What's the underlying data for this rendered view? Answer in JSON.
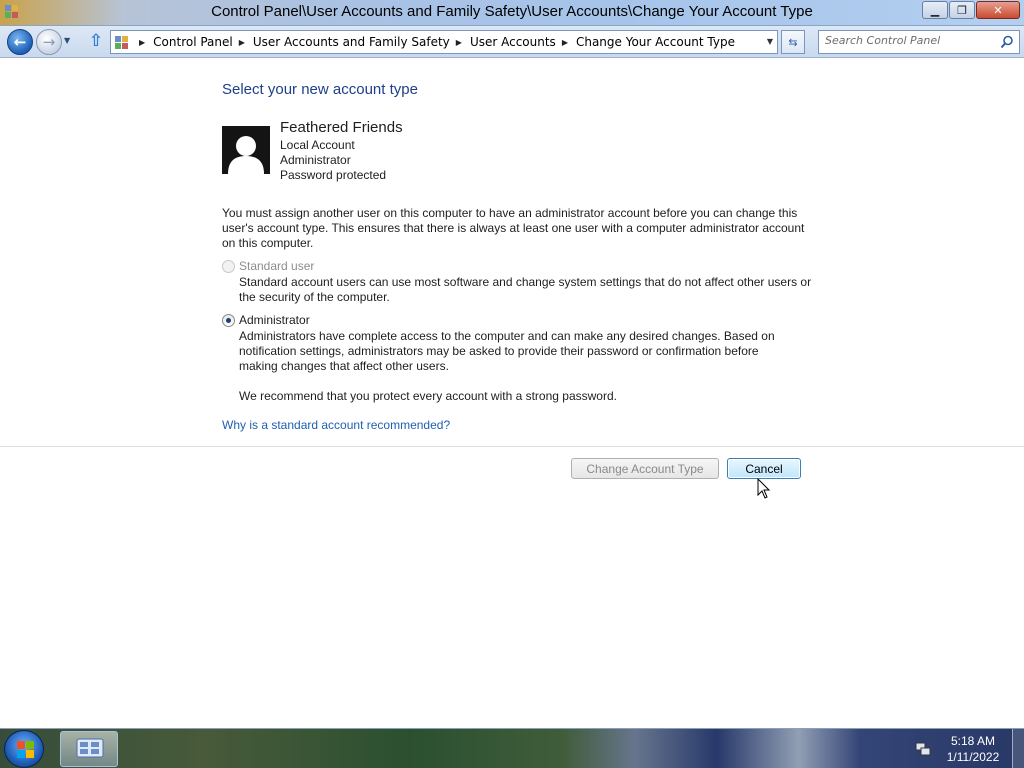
{
  "window": {
    "title": "Control Panel\\User Accounts and Family Safety\\User Accounts\\Change Your Account Type"
  },
  "address": {
    "breadcrumbs": [
      "Control Panel",
      "User Accounts and Family Safety",
      "User Accounts",
      "Change Your Account Type"
    ],
    "search_placeholder": "Search Control Panel"
  },
  "main": {
    "heading": "Select your new account type",
    "user": {
      "name": "Feathered Friends",
      "lines": [
        "Local Account",
        "Administrator",
        "Password protected"
      ]
    },
    "notice": "You must assign another user on this computer to have an administrator account before you can change this user's account type. This ensures that there is always at least one user with a computer administrator account on this computer.",
    "options": [
      {
        "label": "Standard user",
        "description": "Standard account users can use most software and change system settings that do not affect other users or the security of the computer.",
        "checked": false,
        "disabled": true
      },
      {
        "label": "Administrator",
        "description": "Administrators have complete access to the computer and can make any desired changes. Based on notification settings, administrators may be asked to provide their password or confirmation before making changes that affect other users.",
        "checked": true,
        "disabled": false
      }
    ],
    "recommendation": "We recommend that you protect every account with a strong password.",
    "link": "Why is a standard account recommended?",
    "buttons": {
      "change": "Change Account Type",
      "cancel": "Cancel"
    }
  },
  "taskbar": {
    "clock_time": "5:18 AM",
    "clock_date": "1/11/2022"
  },
  "colors": {
    "heading": "#1e3f8a",
    "link": "#1f5fb4",
    "accent": "#3c7fb1"
  }
}
